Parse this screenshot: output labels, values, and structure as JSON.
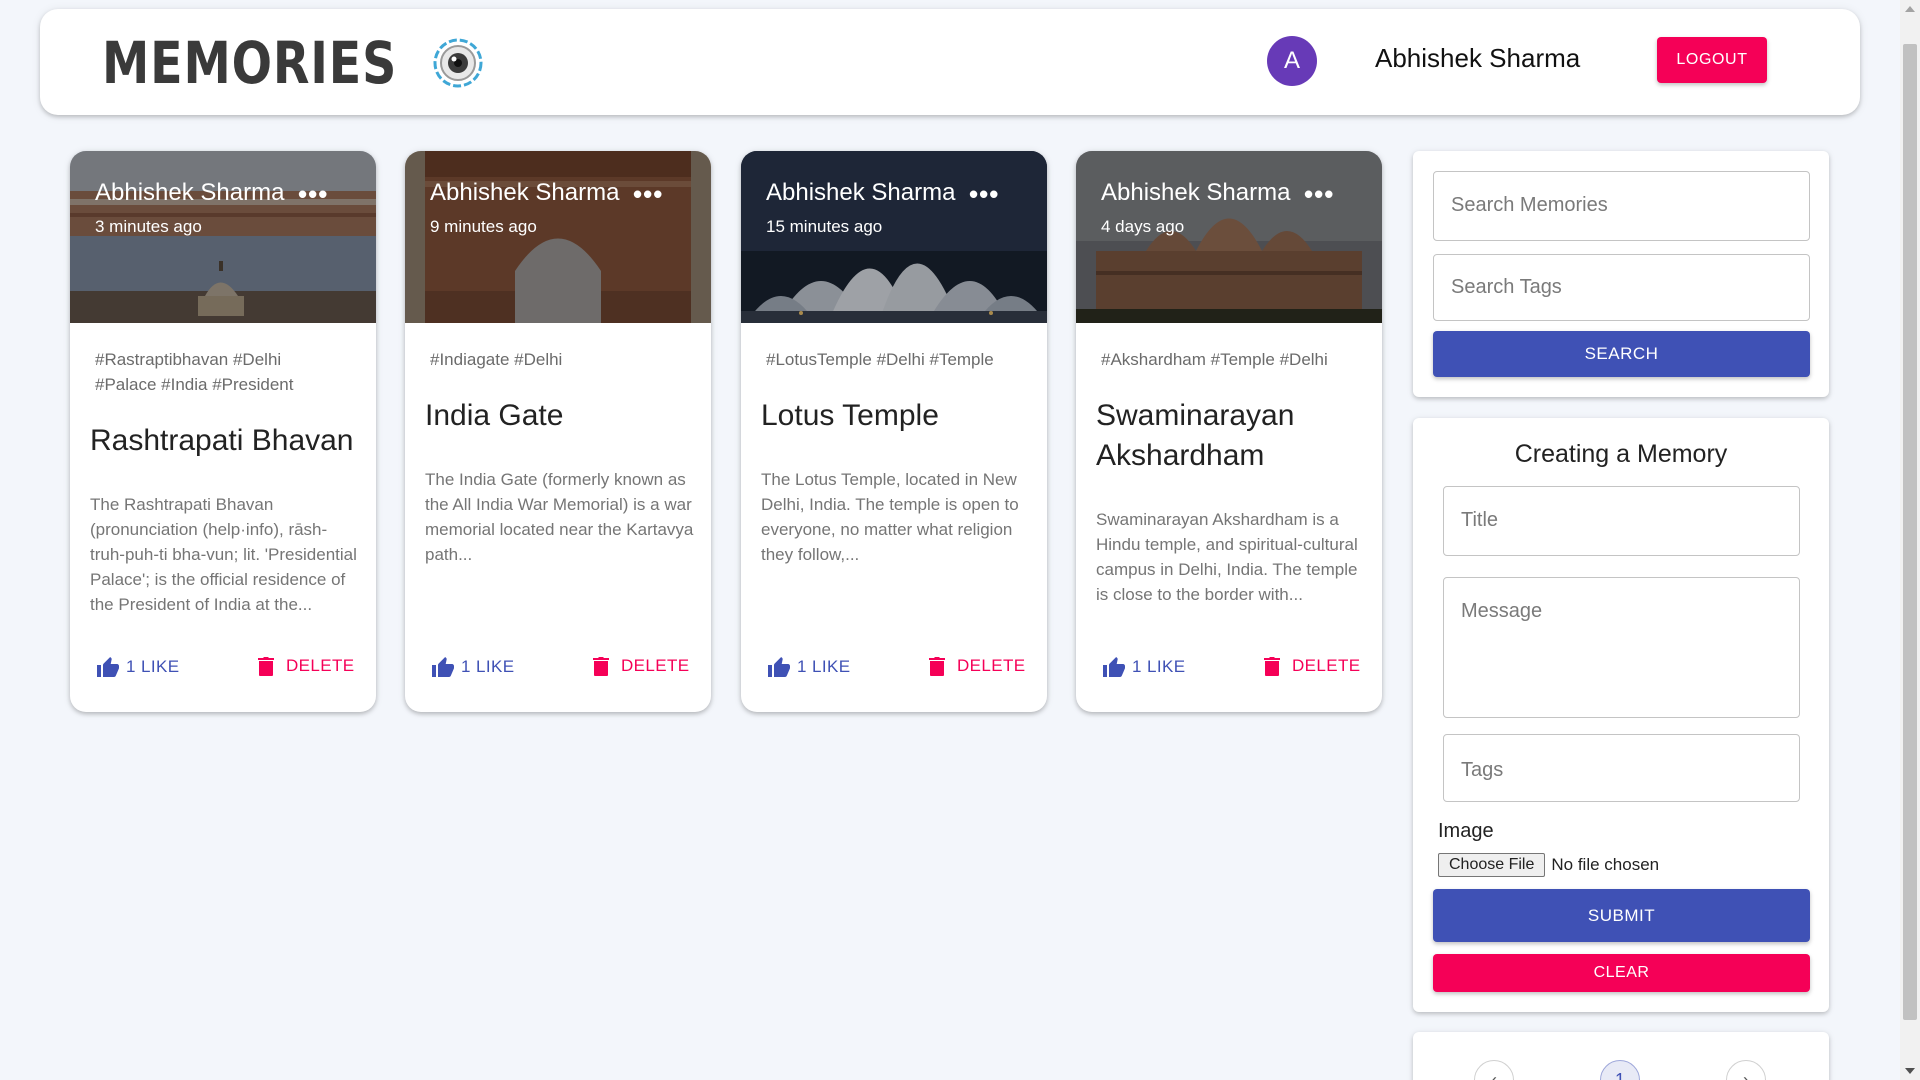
{
  "header": {
    "brand": "MEMORIES",
    "avatar_letter": "A",
    "user_name": "Abhishek Sharma",
    "logout_label": "LOGOUT"
  },
  "posts": [
    {
      "author": "Abhishek Sharma",
      "time": "3 minutes ago",
      "tags": "#Rastraptibhavan #Delhi #Palace #India #President",
      "title": "Rashtrapati Bhavan",
      "message": "The Rashtrapati Bhavan (pronunciation (help·info), rāsh-truh-puh-ti bha-vun; lit. 'Presidential Palace'; is the official residence of the President of India at the...",
      "like_label": "1 LIKE",
      "delete_label": "DELETE"
    },
    {
      "author": "Abhishek Sharma",
      "time": "9 minutes ago",
      "tags": "#Indiagate #Delhi",
      "title": "India Gate",
      "message": "The India Gate (formerly known as the All India War Memorial) is a war memorial located near the Kartavya path...",
      "like_label": "1 LIKE",
      "delete_label": "DELETE"
    },
    {
      "author": "Abhishek Sharma",
      "time": "15 minutes ago",
      "tags": "#LotusTemple #Delhi #Temple",
      "title": "Lotus Temple",
      "message": "The Lotus Temple, located in New Delhi, India. The temple is open to everyone, no matter what religion they follow,...",
      "like_label": "1 LIKE",
      "delete_label": "DELETE"
    },
    {
      "author": "Abhishek Sharma",
      "time": "4 days ago",
      "tags": "#Akshardham #Temple #Delhi",
      "title": "Swaminarayan Akshardham",
      "message": "Swaminarayan Akshardham is a Hindu temple, and spiritual-cultural campus in Delhi, India. The temple is close to the border with...",
      "like_label": "1 LIKE",
      "delete_label": "DELETE"
    }
  ],
  "search": {
    "memories_placeholder": "Search Memories",
    "tags_placeholder": "Search Tags",
    "button_label": "SEARCH"
  },
  "form": {
    "title": "Creating a Memory",
    "title_placeholder": "Title",
    "message_placeholder": "Message",
    "tags_placeholder": "Tags",
    "image_label": "Image",
    "choose_file_label": "Choose File",
    "file_status": "No file chosen",
    "submit_label": "SUBMIT",
    "clear_label": "CLEAR"
  },
  "pagination": {
    "prev": "‹",
    "current": "1",
    "next": "›"
  },
  "colors": {
    "primary": "#3f51b5",
    "secondary": "#f50057",
    "avatar": "#673ab7"
  }
}
